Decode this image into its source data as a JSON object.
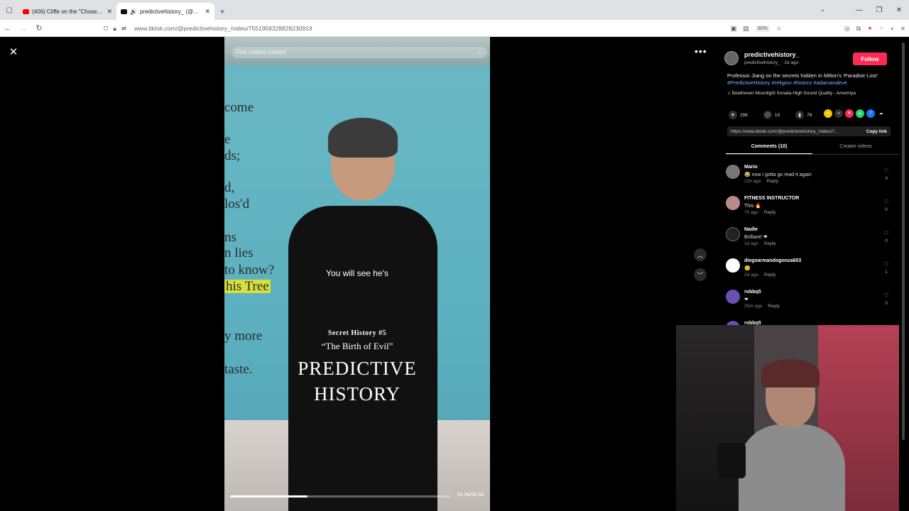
{
  "browser": {
    "tabs": [
      {
        "title": "(406) Cliffe on the \"Chosen Peo",
        "favicon_color": "#ff0000",
        "active": false
      },
      {
        "title": "predictivehistory_ (@predic",
        "favicon_color": "#111111",
        "active": true
      }
    ],
    "url": "www.tiktok.com/@predictivehistory_/video/7551959328828230919",
    "zoom": "80%"
  },
  "video": {
    "search_placeholder": "Find related content",
    "board_lines": [
      "come",
      "e",
      "ds;",
      "d,",
      "los'd",
      "ns",
      "n lies",
      "to know?",
      "his Tree",
      "y more",
      "taste."
    ],
    "subtitle": "You will see he's",
    "title_small": "Secret History #5",
    "title_quote": "“The Birth of Evil”",
    "brand_line1": "PREDICTIVE",
    "brand_line2": "HISTORY",
    "time": "01:36/04:34",
    "progress": 0.35
  },
  "post": {
    "username": "predictivehistory_",
    "subline": "predictivehistory_ · 2d ago",
    "follow_label": "Follow",
    "description": "Professor Jiang on the secrets hidden in Milton's 'Paradise Lost'",
    "hashtags": "#PredictiveHistory #religion #history #adamandeve",
    "music": "♫ Beethoven Moonlight Sonata-High Sound Quality - Amemiya",
    "likes": "296",
    "comments_count": "10",
    "saves": "78",
    "link": "https://www.tiktok.com/@predictivehistory_/video/7...",
    "copy_label": "Copy link",
    "tab_comments": "Comments (10)",
    "tab_creator": "Creator videos"
  },
  "comments": [
    {
      "name": "Mario",
      "text": "😂 now i gotta go read it again",
      "time": "21h ago",
      "reply": "Reply",
      "likes": "3"
    },
    {
      "name": "FITNESS INSTRUCTOR",
      "text": "This 🔥",
      "time": "7h ago",
      "reply": "Reply",
      "likes": "0"
    },
    {
      "name": "Nadie",
      "text": "Brilliant! ❤",
      "time": "1d ago",
      "reply": "Reply",
      "likes": "0"
    },
    {
      "name": "diegoarmandogonza603",
      "text": "😊",
      "time": "2d ago",
      "reply": "Reply",
      "likes": "1"
    },
    {
      "name": "robbq5",
      "text": "❤",
      "time": "25m ago",
      "reply": "Reply",
      "likes": "0"
    },
    {
      "name": "robbq5",
      "text": "",
      "time": "",
      "reply": "",
      "likes": ""
    }
  ]
}
